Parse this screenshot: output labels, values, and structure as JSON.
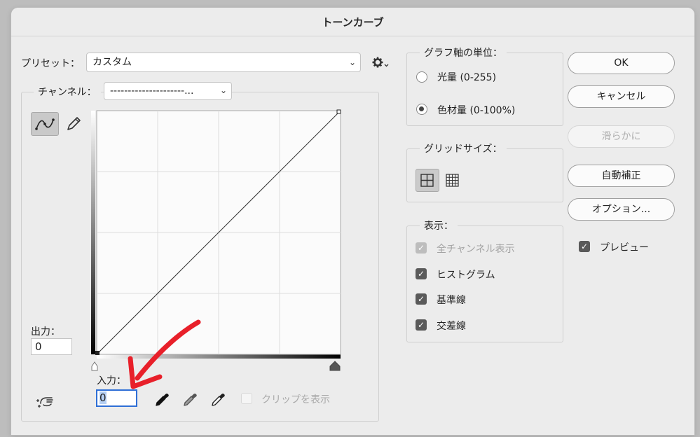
{
  "window": {
    "title": "トーンカーブ"
  },
  "preset": {
    "label": "プリセット：",
    "value": "カスタム"
  },
  "channel": {
    "label": "チャンネル：",
    "value": "---------------------..."
  },
  "output": {
    "label": "出力：",
    "value": "0"
  },
  "input": {
    "label": "入力：",
    "value": "0"
  },
  "clip": {
    "label": "クリップを表示",
    "checked": false
  },
  "graph_unit": {
    "legend": "グラフ軸の単位：",
    "options": [
      {
        "label": "光量 (0-255)",
        "selected": false
      },
      {
        "label": "色材量 (0-100%)",
        "selected": true
      }
    ]
  },
  "grid_size": {
    "legend": "グリッドサイズ："
  },
  "display": {
    "legend": "表示：",
    "items": [
      {
        "label": "全チャンネル表示",
        "checked": true,
        "disabled": true
      },
      {
        "label": "ヒストグラム",
        "checked": true
      },
      {
        "label": "基準線",
        "checked": true
      },
      {
        "label": "交差線",
        "checked": true
      }
    ]
  },
  "buttons": {
    "ok": "OK",
    "cancel": "キャンセル",
    "smooth": "滑らかに",
    "auto": "自動補正",
    "options": "オプション..."
  },
  "preview": {
    "label": "プレビュー",
    "checked": true
  },
  "icons": {
    "curve_tool": "curve-point-icon",
    "pencil_tool": "pencil-icon",
    "gear": "gear-icon",
    "hand": "on-image-adjust-icon",
    "eyedroppers": [
      "black-point-eyedropper-icon",
      "gray-point-eyedropper-icon",
      "white-point-eyedropper-icon"
    ],
    "annotation": "red-arrow-annotation"
  },
  "colors": {
    "annotation": "#e8202a",
    "input_focus": "#2f6fd6"
  }
}
